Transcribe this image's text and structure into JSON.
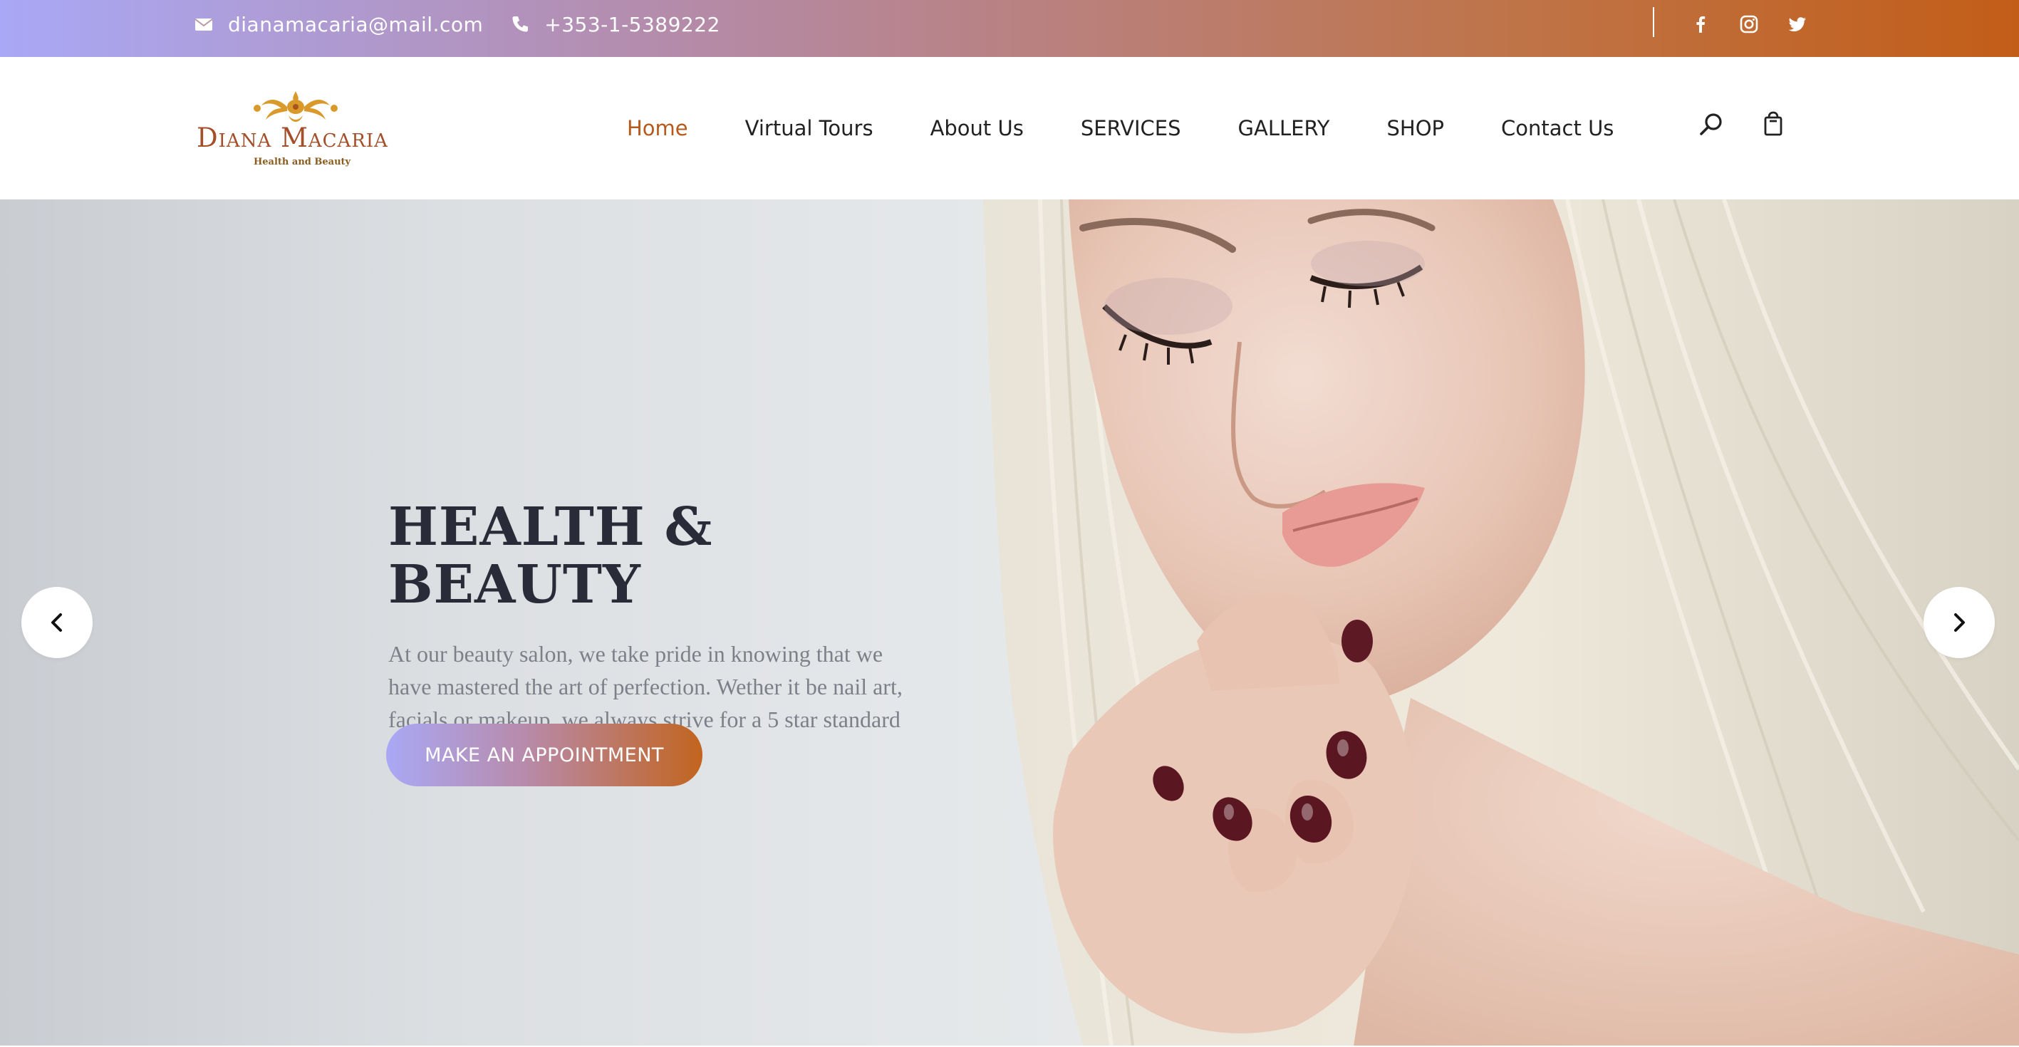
{
  "topbar": {
    "email": "dianamacaria@mail.com",
    "phone": "+353-1-5389222",
    "email_icon": "envelope-icon",
    "phone_icon": "phone-icon",
    "social": [
      "facebook-icon",
      "instagram-icon",
      "twitter-icon"
    ],
    "gradient": [
      "#a9a8f6",
      "#c25d18"
    ]
  },
  "header": {
    "logo": {
      "brand": "Diana Macaria",
      "tagline": "Health and Beauty"
    },
    "nav": [
      {
        "label": "Home",
        "active": true
      },
      {
        "label": "Virtual Tours",
        "active": false
      },
      {
        "label": "About Us",
        "active": false
      },
      {
        "label": "SERVICES",
        "active": false
      },
      {
        "label": "GALLERY",
        "active": false
      },
      {
        "label": "SHOP",
        "active": false
      },
      {
        "label": "Contact Us",
        "active": false
      }
    ],
    "icons": [
      "search-icon",
      "shopping-bag-icon"
    ],
    "active_color": "#b55a1b"
  },
  "hero": {
    "title": "HEALTH & BEAUTY",
    "description": "At our beauty salon, we take pride in knowing that we have mastered the art of perfection. Wether it be nail art, facials or makeup, we always strive for a 5 star standard",
    "cta": "MAKE AN APPOINTMENT",
    "prev_icon": "chevron-left-icon",
    "next_icon": "chevron-right-icon"
  }
}
